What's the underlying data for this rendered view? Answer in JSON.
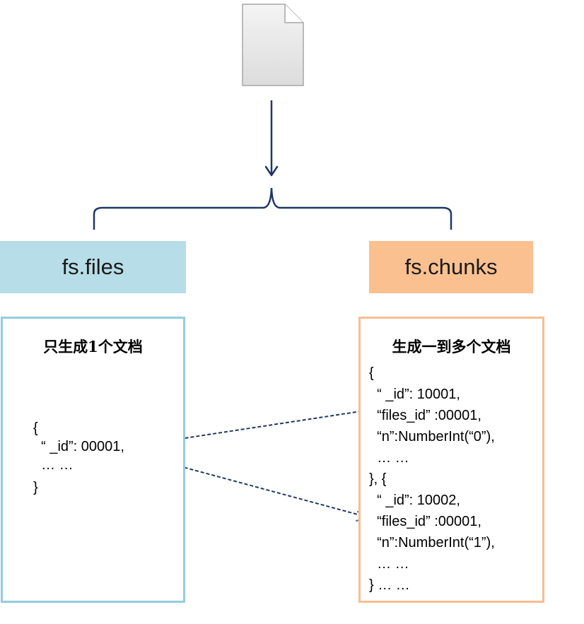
{
  "file_icon": "document-icon",
  "fs_files": {
    "label": "fs.files",
    "title": "只生成1个文档",
    "lines": [
      "{",
      "  “ _id”: 00001,",
      "  … …",
      "}"
    ]
  },
  "fs_chunks": {
    "label": "fs.chunks",
    "title": "生成一到多个文档",
    "lines": [
      "{",
      "  “ _id”: 10001,",
      "  “files_id” :00001,",
      "  “n”:NumberInt(“0”),",
      "  … …",
      "}, {",
      "  “ _id”: 10002,",
      "  “files_id” :00001,",
      "  “n”:NumberInt(“1”),",
      "  … …",
      "} … …"
    ]
  },
  "colors": {
    "connector": "#1f3864",
    "files_fill": "#b7dde8",
    "files_border": "#93cddd",
    "chunks_fill": "#fac090",
    "chunks_border": "#f9be8f",
    "dashed_arrow": "#4a76b5"
  }
}
